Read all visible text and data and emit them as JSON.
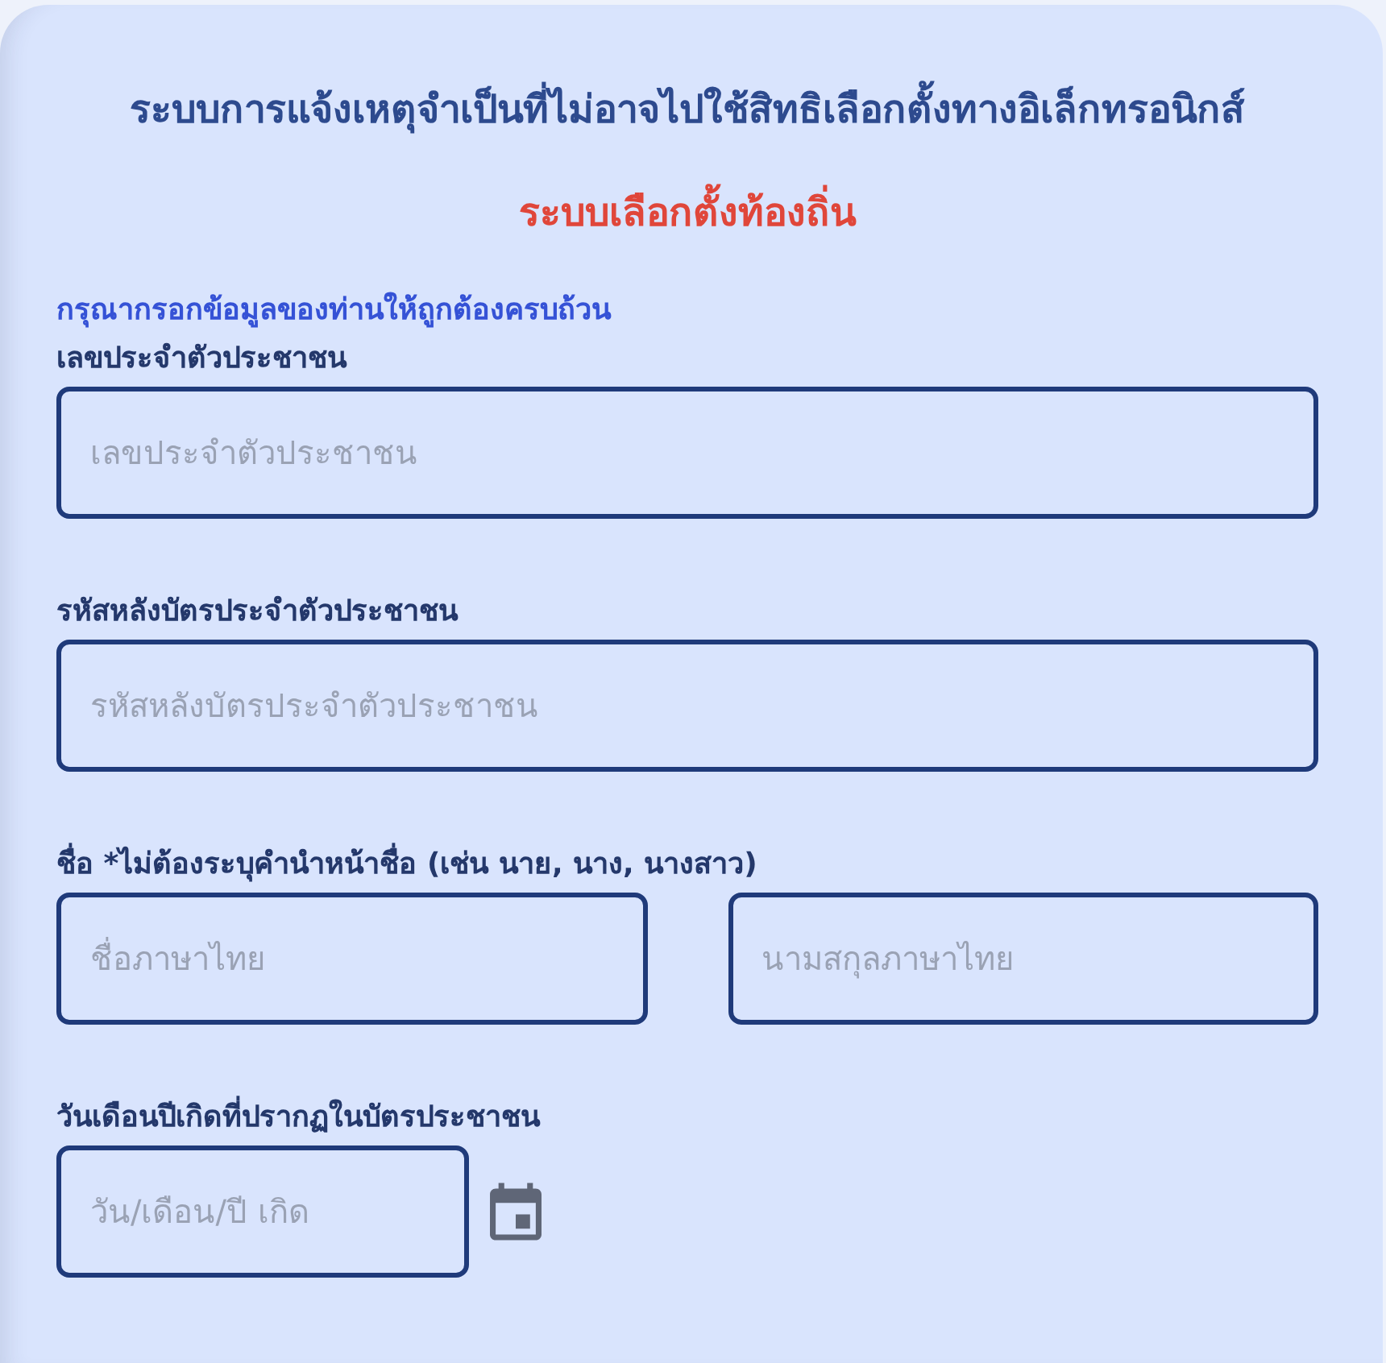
{
  "title": "ระบบการแจ้งเหตุจำเป็นที่ไม่อาจไปใช้สิทธิเลือกตั้งทางอิเล็กทรอนิกส์",
  "subtitle": "ระบบเลือกตั้งท้องถิ่น",
  "instruction": "กรุณากรอกข้อมูลของท่านให้ถูกต้องครบถ้วน",
  "fields": [
    {
      "kind": "text",
      "label": "เลขประจำตัวประชาชน",
      "inputs": [
        {
          "placeholder": "เลขประจำตัวประชาชน"
        }
      ]
    },
    {
      "kind": "text",
      "label": "รหัสหลังบัตรประจำตัวประชาชน",
      "inputs": [
        {
          "placeholder": "รหัสหลังบัตรประจำตัวประชาชน"
        }
      ]
    },
    {
      "kind": "text",
      "label": "ชื่อ *ไม่ต้องระบุคำนำหน้าชื่อ (เช่น นาย, นาง, นางสาว)",
      "inputs": [
        {
          "placeholder": "ชื่อภาษาไทย"
        },
        {
          "placeholder": "นามสกุลภาษาไทย"
        }
      ]
    },
    {
      "kind": "date",
      "label": "วันเดือนปีเกิดที่ปรากฏในบัตรประชาชน",
      "inputs": [
        {
          "placeholder": "วัน/เดือน/ปี เกิด"
        }
      ]
    }
  ]
}
